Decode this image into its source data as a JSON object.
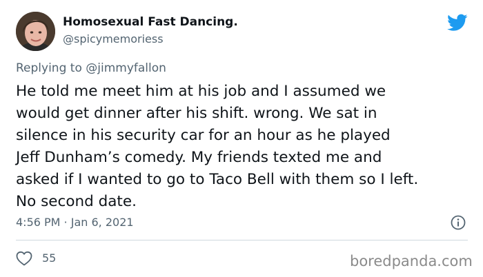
{
  "tweet": {
    "display_name": "Homosexual Fast Dancing.",
    "handle": "@spicymemoriess",
    "reply_prefix": "Replying to ",
    "reply_to": "@jimmyfallon",
    "text": "He told me meet him at his job and I assumed we\nwould get dinner after his shift. wrong. We sat in\nsilence in his security car for an hour as he played\nJeff Dunham’s comedy. My friends texted me and\nasked if I wanted to go to Taco Bell with them so I left.\nNo second date.",
    "timestamp": "4:56 PM · Jan 6, 2021",
    "like_count": "55"
  },
  "icons": {
    "brand": "twitter-bird-icon",
    "info": "info-icon",
    "like": "heart-icon"
  },
  "colors": {
    "twitter_blue": "#1d9bf0",
    "secondary_text": "#536471",
    "divider": "#cfd9de",
    "watermark": "#8a8a8a"
  },
  "watermark": "boredpanda.com"
}
